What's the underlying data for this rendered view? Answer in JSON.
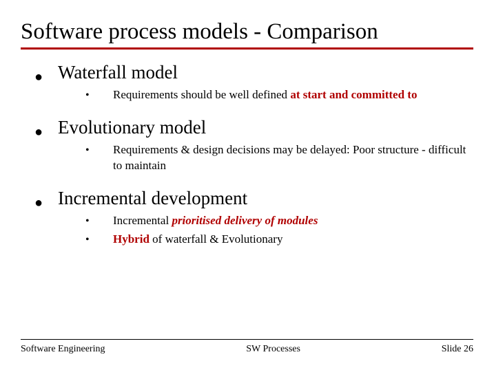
{
  "title": "Software process models - Comparison",
  "items": [
    {
      "heading": "Waterfall model",
      "subs": [
        {
          "prefix": "Requirements  should be well defined ",
          "em": "at start and committed to",
          "emClass": "red bold"
        }
      ]
    },
    {
      "heading": "Evolutionary model",
      "subs": [
        {
          "prefix": "Requirements & design decisions may be delayed: Poor structure - difficult to maintain",
          "em": "",
          "emClass": ""
        }
      ]
    },
    {
      "heading": "Incremental development",
      "subs": [
        {
          "prefix": "Incremental ",
          "em": "prioritised delivery of modules",
          "emClass": "red bold italic"
        },
        {
          "prefix": "",
          "em": "Hybrid",
          "emClass": "red bold",
          "suffix": " of waterfall & Evolutionary"
        }
      ]
    }
  ],
  "footer": {
    "left": "Software Engineering",
    "center": "SW Processes",
    "right": "Slide 26"
  }
}
